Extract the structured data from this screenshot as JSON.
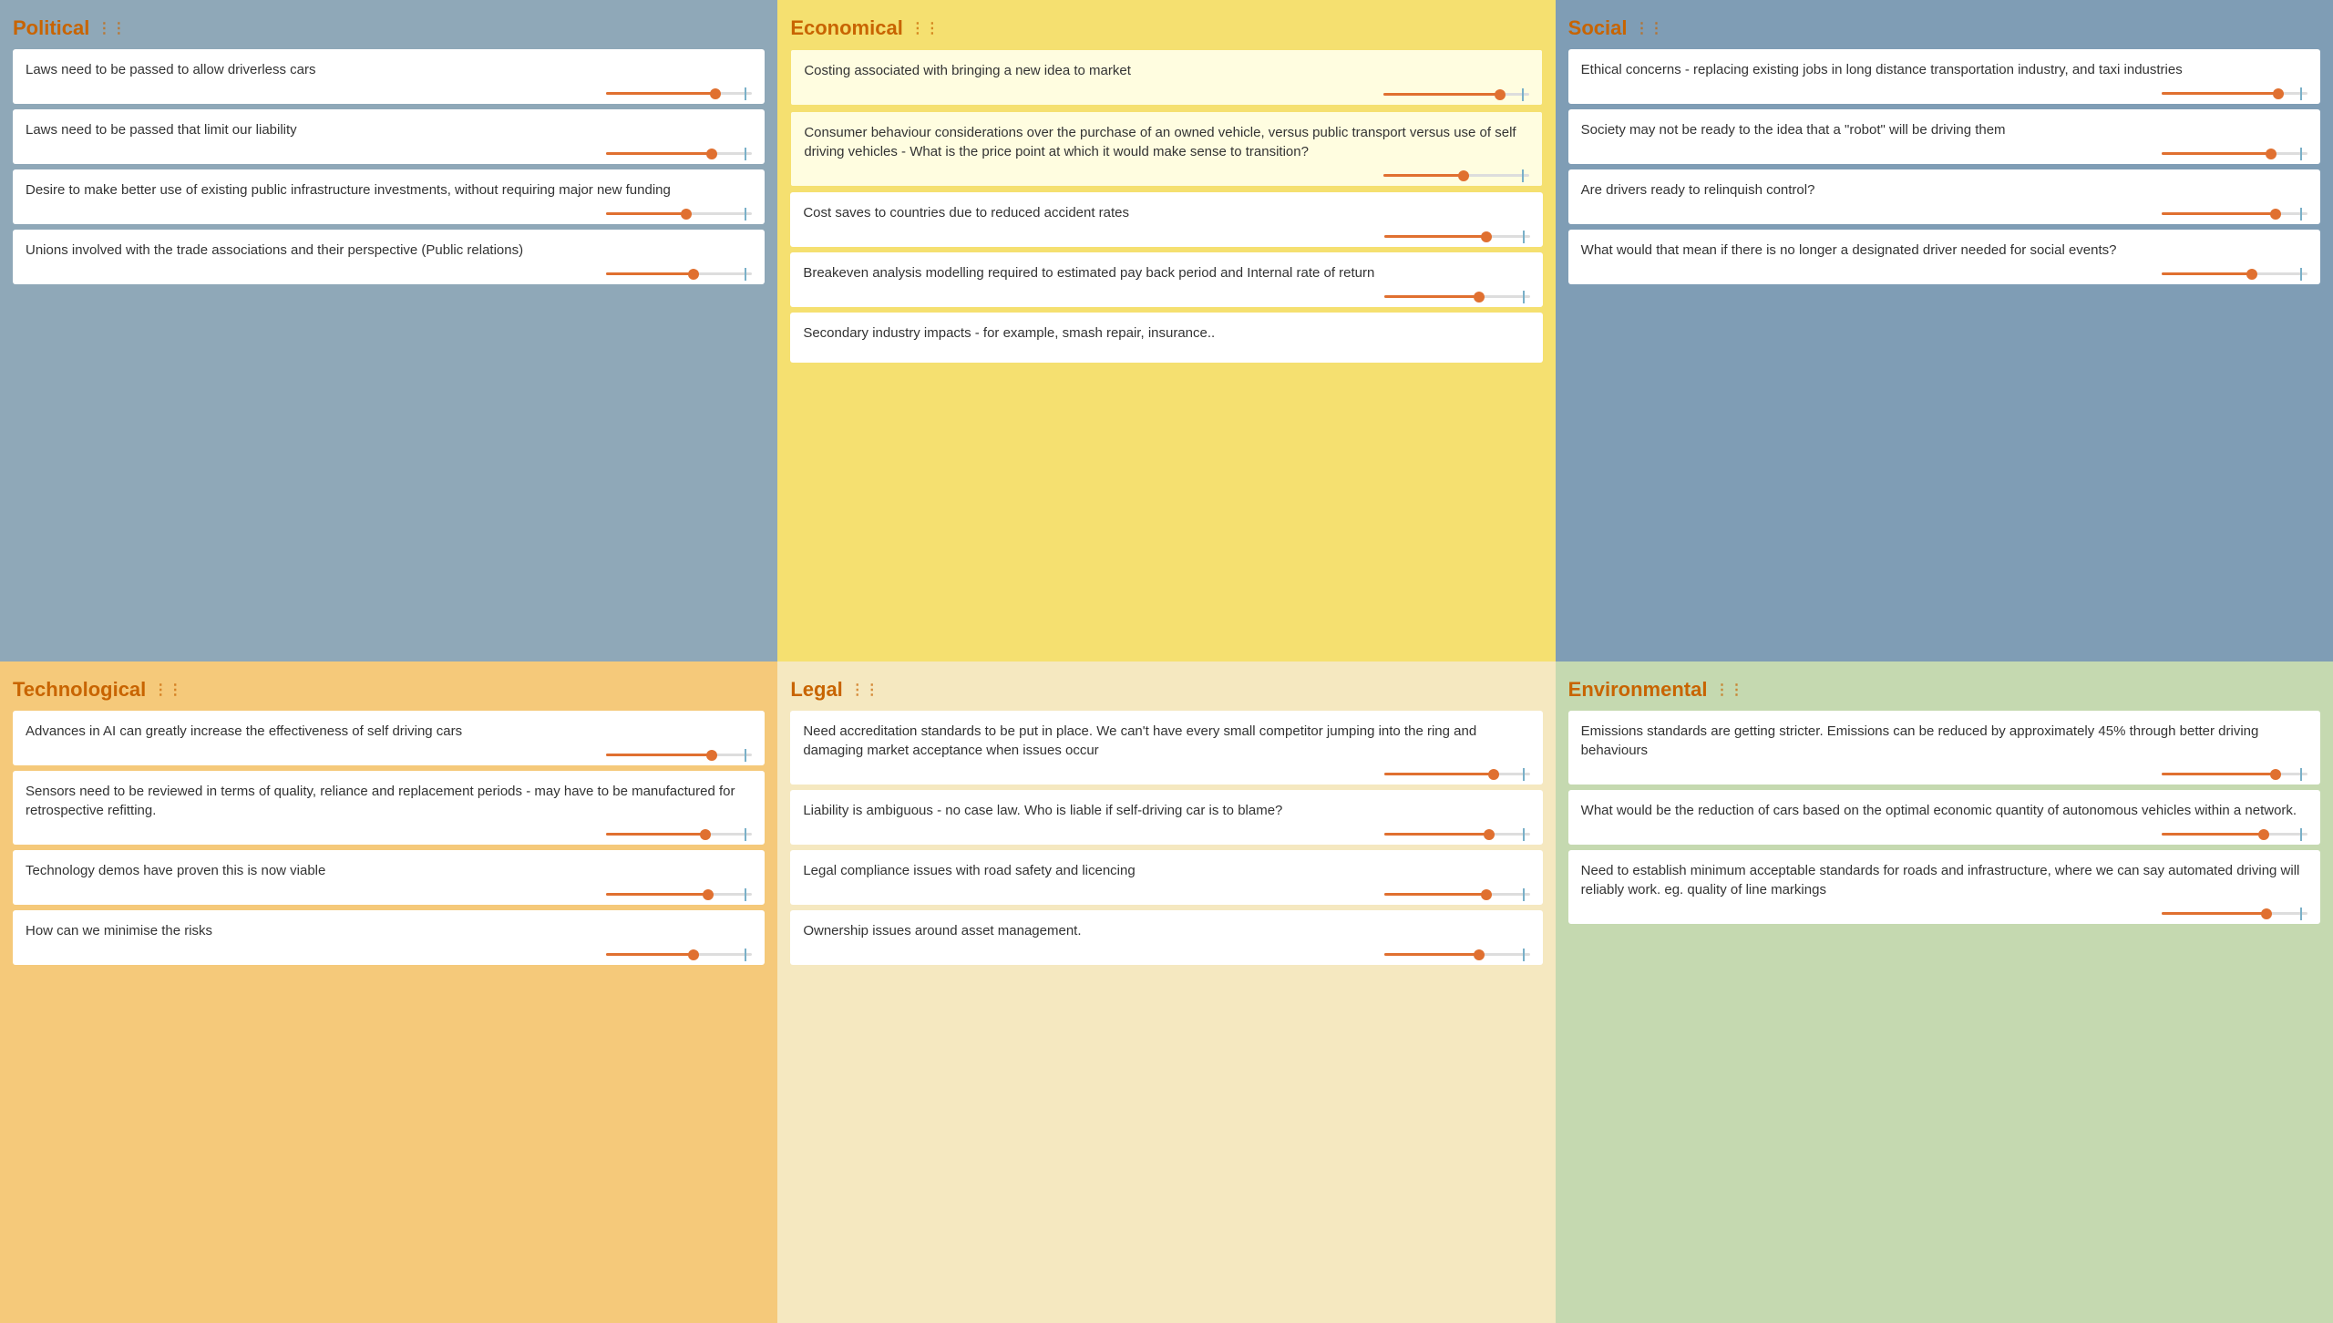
{
  "sections": [
    {
      "id": "political",
      "title": "Political",
      "colorClass": "section-political",
      "cards": [
        {
          "text": "Laws need to be passed to allow driverless cars",
          "fill": 75
        },
        {
          "text": "Laws need to be passed that limit our liability",
          "fill": 72
        },
        {
          "text": "Desire to make better use of existing public infrastructure investments, without requiring major new funding",
          "fill": 55
        },
        {
          "text": "Unions involved with the trade associations and their perspective (Public relations)",
          "fill": 60
        }
      ]
    },
    {
      "id": "economical",
      "title": "Economical",
      "colorClass": "section-economical",
      "cards": [
        {
          "text": "Costing associated with bringing a new idea to market",
          "fill": 80,
          "highlighted": true
        },
        {
          "text": "Consumer behaviour considerations over the purchase of an owned vehicle, versus public transport versus use of self driving vehicles - What is the price point at which it would make sense to transition?",
          "fill": 55,
          "highlighted": true
        },
        {
          "text": "Cost saves to countries due to reduced accident rates",
          "fill": 70
        },
        {
          "text": "Breakeven analysis modelling required to estimated pay back period and Internal rate of return",
          "fill": 65
        },
        {
          "text": "Secondary industry impacts - for example, smash repair, insurance..",
          "fill": 0
        }
      ]
    },
    {
      "id": "social",
      "title": "Social",
      "colorClass": "section-social",
      "cards": [
        {
          "text": "Ethical concerns - replacing existing jobs in long distance transportation industry, and taxi industries",
          "fill": 80
        },
        {
          "text": "Society may not be ready to the idea that a \"robot\" will be driving them",
          "fill": 75
        },
        {
          "text": "Are drivers ready to relinquish control?",
          "fill": 78
        },
        {
          "text": "What would that mean if there is no longer a designated driver needed for social events?",
          "fill": 62
        }
      ]
    },
    {
      "id": "technological",
      "title": "Technological",
      "colorClass": "section-technological",
      "cards": [
        {
          "text": "Advances in AI can greatly increase the effectiveness of self driving cars",
          "fill": 72
        },
        {
          "text": "Sensors need to be reviewed in terms of quality, reliance and replacement periods - may have to be manufactured for retrospective refitting.",
          "fill": 68
        },
        {
          "text": "Technology demos have proven this is now viable",
          "fill": 70
        },
        {
          "text": "How can we minimise the risks",
          "fill": 60
        }
      ]
    },
    {
      "id": "legal",
      "title": "Legal",
      "colorClass": "section-legal",
      "cards": [
        {
          "text": "Need accreditation standards to be put in place. We can't have every small competitor jumping into the ring and damaging market acceptance when issues occur",
          "fill": 75
        },
        {
          "text": "Liability is ambiguous - no case law. Who is liable if self-driving car is to blame?",
          "fill": 72
        },
        {
          "text": "Legal compliance issues with road safety and licencing",
          "fill": 70
        },
        {
          "text": "Ownership issues around asset management.",
          "fill": 65
        }
      ]
    },
    {
      "id": "environmental",
      "title": "Environmental",
      "colorClass": "section-environmental",
      "cards": [
        {
          "text": "Emissions standards are getting stricter. Emissions can be reduced by approximately 45% through better driving behaviours",
          "fill": 78
        },
        {
          "text": "What would be the reduction of cars based on the optimal economic quantity of autonomous vehicles within a network.",
          "fill": 70
        },
        {
          "text": "Need to establish minimum acceptable standards for roads and infrastructure, where we can say automated driving will reliably work. eg. quality of line markings",
          "fill": 72
        }
      ]
    }
  ]
}
